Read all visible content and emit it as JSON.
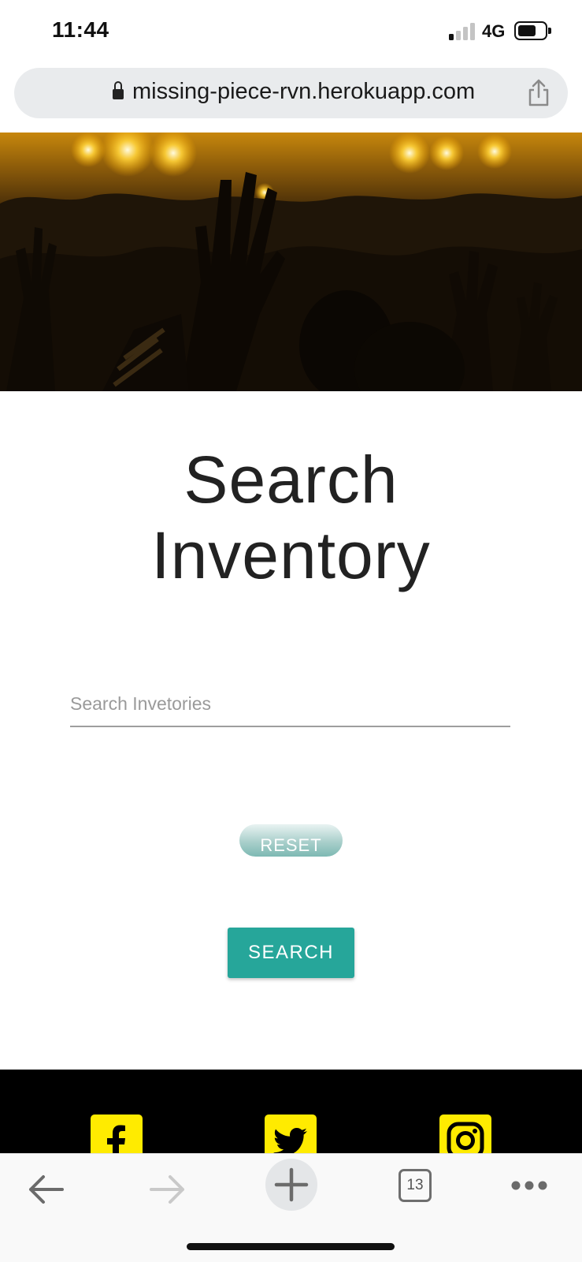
{
  "status_bar": {
    "time": "11:44",
    "network": "4G"
  },
  "browser": {
    "url": "missing-piece-rvn.herokuapp.com",
    "tabs_count": "13"
  },
  "main": {
    "title_line1": "Search",
    "title_line2": "Inventory",
    "search_placeholder": "Search Invetories",
    "reset_label": "RESET",
    "search_label": "SEARCH"
  },
  "footer": {
    "social": [
      "facebook-icon",
      "twitter-icon",
      "instagram-icon"
    ]
  },
  "colors": {
    "accent": "#26a69a",
    "footer_bg": "#000000",
    "social_bg": "#ffeb00"
  }
}
